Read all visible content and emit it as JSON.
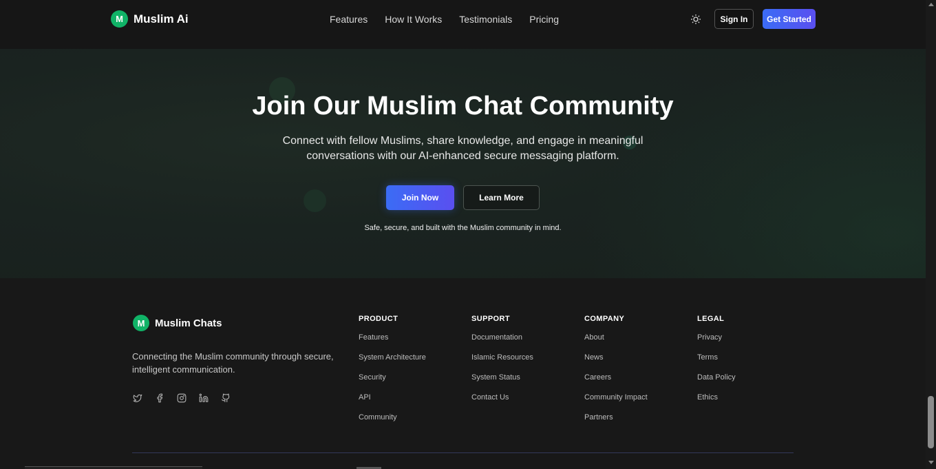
{
  "header": {
    "logo_letter": "M",
    "logo_text": "Muslim Ai",
    "nav": [
      "Features",
      "How It Works",
      "Testimonials",
      "Pricing"
    ],
    "theme_icon": "sun-icon",
    "sign_in": "Sign In",
    "get_started": "Get Started"
  },
  "hero": {
    "title": "Join Our Muslim Chat Community",
    "subtitle": "Connect with fellow Muslims, share knowledge, and engage in meaningful conversations with our AI-enhanced secure messaging platform.",
    "join_now": "Join Now",
    "learn_more": "Learn More",
    "note": "Safe, secure, and built with the Muslim community in mind."
  },
  "footer": {
    "logo_letter": "M",
    "logo_text": "Muslim Chats",
    "description": "Connecting the Muslim community through secure, intelligent communication.",
    "socials": [
      "twitter-icon",
      "facebook-icon",
      "instagram-icon",
      "linkedin-icon",
      "github-icon"
    ],
    "columns": [
      {
        "title": "PRODUCT",
        "links": [
          "Features",
          "System Architecture",
          "Security",
          "API",
          "Community"
        ]
      },
      {
        "title": "SUPPORT",
        "links": [
          "Documentation",
          "Islamic Resources",
          "System Status",
          "Contact Us"
        ]
      },
      {
        "title": "COMPANY",
        "links": [
          "About",
          "News",
          "Careers",
          "Community Impact",
          "Partners"
        ]
      },
      {
        "title": "LEGAL",
        "links": [
          "Privacy",
          "Terms",
          "Data Policy",
          "Ethics"
        ]
      }
    ]
  },
  "colors": {
    "accent_blue": "#3b6cf5",
    "accent_purple": "#5a4ff0",
    "brand_green": "#10b367",
    "background": "#181818"
  }
}
